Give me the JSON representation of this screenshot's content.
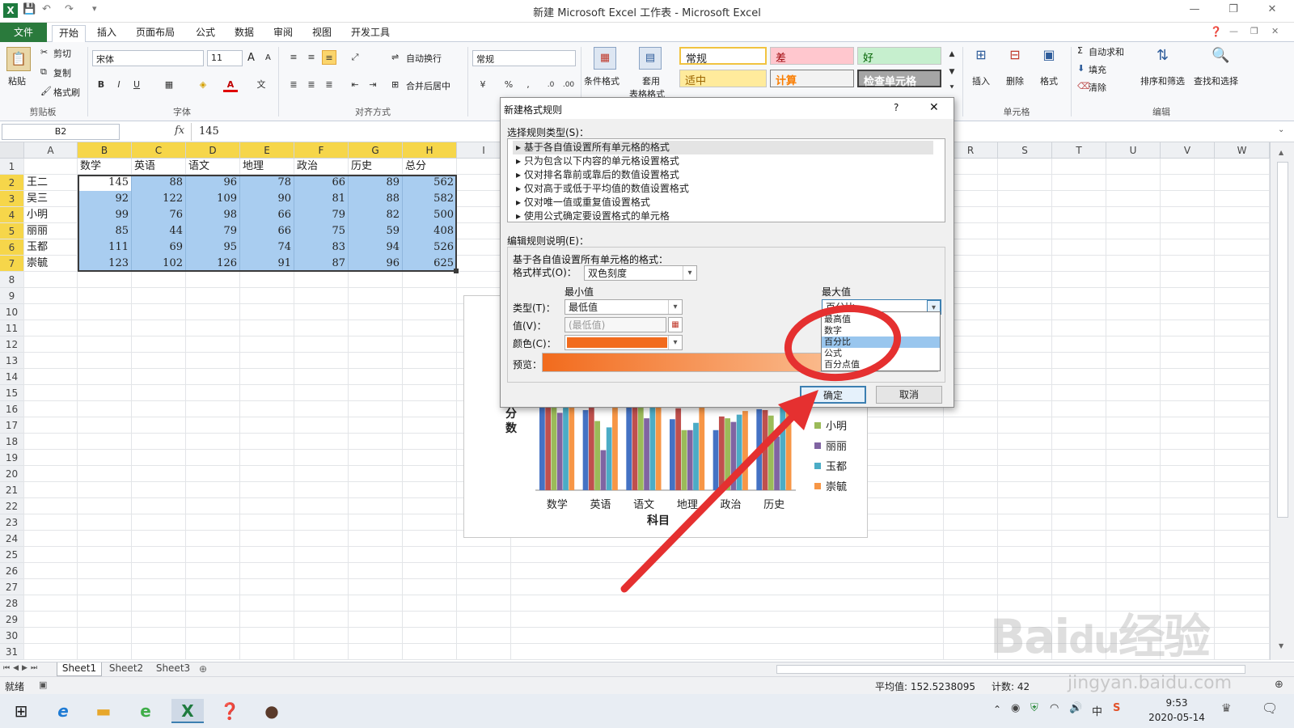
{
  "app": {
    "title": "新建 Microsoft Excel 工作表 - Microsoft Excel",
    "quick_access_menu": "▾"
  },
  "menu": {
    "file": "文件",
    "tabs": [
      "开始",
      "插入",
      "页面布局",
      "公式",
      "数据",
      "审阅",
      "视图",
      "开发工具"
    ]
  },
  "ribbon": {
    "clipboard": {
      "paste": "粘贴",
      "cut": "剪切",
      "copy": "复制",
      "format_painter": "格式刷",
      "label": "剪贴板"
    },
    "font": {
      "name": "宋体",
      "size": "11",
      "grow": "A",
      "shrink": "A",
      "bold": "B",
      "italic": "I",
      "underline": "U",
      "font_color_letter": "A",
      "label": "字体"
    },
    "alignment": {
      "wrap": "自动换行",
      "merge": "合并后居中",
      "label": "对齐方式"
    },
    "number": {
      "format": "常规",
      "percent": "%",
      "comma": ","
    },
    "styles": {
      "conditional": "条件格式",
      "table": "套用",
      "table2": "表格格式",
      "normal": "常规",
      "bad": "差",
      "good": "好",
      "neutral": "适中",
      "calc": "计算",
      "check": "检查单元格"
    },
    "cells": {
      "insert": "插入",
      "delete": "删除",
      "format": "格式",
      "label": "单元格"
    },
    "editing": {
      "autosum": "自动求和",
      "fill": "填充",
      "clear": "清除",
      "sort": "排序和筛选",
      "find": "查找和选择",
      "label": "编辑"
    }
  },
  "formula_bar": {
    "name_box": "B2",
    "fx": "fx",
    "value": "145"
  },
  "columns_left": [
    "A",
    "B",
    "C",
    "D",
    "E",
    "F",
    "G",
    "H",
    "I"
  ],
  "columns_right": [
    "R",
    "S",
    "T",
    "U",
    "V",
    "W"
  ],
  "rows": [
    "1",
    "2",
    "3",
    "4",
    "5",
    "6",
    "7",
    "8",
    "9",
    "10",
    "11",
    "12",
    "13",
    "14",
    "15",
    "16",
    "17",
    "18",
    "19",
    "20",
    "21",
    "22",
    "23",
    "24",
    "25",
    "26",
    "27",
    "28",
    "29",
    "30",
    "31"
  ],
  "table": {
    "headers": [
      "",
      "数学",
      "英语",
      "语文",
      "地理",
      "政治",
      "历史",
      "总分"
    ],
    "data": [
      [
        "王二",
        "145",
        "88",
        "96",
        "78",
        "66",
        "89",
        "562"
      ],
      [
        "吴三",
        "92",
        "122",
        "109",
        "90",
        "81",
        "88",
        "582"
      ],
      [
        "小明",
        "99",
        "76",
        "98",
        "66",
        "79",
        "82",
        "500"
      ],
      [
        "丽丽",
        "85",
        "44",
        "79",
        "66",
        "75",
        "59",
        "408"
      ],
      [
        "玉都",
        "111",
        "69",
        "95",
        "74",
        "83",
        "94",
        "526"
      ],
      [
        "崇毓",
        "123",
        "102",
        "126",
        "91",
        "87",
        "96",
        "625"
      ]
    ]
  },
  "chart_data": {
    "type": "bar",
    "categories": [
      "数学",
      "英语",
      "语文",
      "地理",
      "政治",
      "历史"
    ],
    "series": [
      {
        "name": "王二",
        "values": [
          145,
          88,
          96,
          78,
          66,
          89
        ],
        "color": "#4472c4"
      },
      {
        "name": "吴三",
        "values": [
          92,
          122,
          109,
          90,
          81,
          88
        ],
        "color": "#c0504d"
      },
      {
        "name": "小明",
        "values": [
          99,
          76,
          98,
          66,
          79,
          82
        ],
        "color": "#9bbb59"
      },
      {
        "name": "丽丽",
        "values": [
          85,
          44,
          79,
          66,
          75,
          59
        ],
        "color": "#8064a2"
      },
      {
        "name": "玉都",
        "values": [
          111,
          69,
          95,
          74,
          83,
          94
        ],
        "color": "#4bacc6"
      },
      {
        "name": "崇毓",
        "values": [
          123,
          102,
          126,
          91,
          87,
          96
        ],
        "color": "#f79646"
      }
    ],
    "xlabel": "科目",
    "ylabel": "分数",
    "legend_position": "right",
    "visible_legend": [
      "小明",
      "丽丽",
      "玉都",
      "崇毓"
    ]
  },
  "dialog": {
    "title": "新建格式规则",
    "help": "?",
    "close": "✕",
    "rule_type_label": "选择规则类型(S)：",
    "rule_types": [
      "基于各自值设置所有单元格的格式",
      "只为包含以下内容的单元格设置格式",
      "仅对排名靠前或靠后的数值设置格式",
      "仅对高于或低于平均值的数值设置格式",
      "仅对唯一值或重复值设置格式",
      "使用公式确定要设置格式的单元格"
    ],
    "edit_label": "编辑规则说明(E)：",
    "edit_desc": "基于各自值设置所有单元格的格式：",
    "style_label": "格式样式(O)：",
    "style_value": "双色刻度",
    "min_label": "最小值",
    "max_label": "最大值",
    "type_label": "类型(T)：",
    "value_label": "值(V)：",
    "color_label": "颜色(C)：",
    "preview_label": "预览：",
    "min_type": "最低值",
    "min_value_placeholder": "(最低值)",
    "max_type": "百分比",
    "max_options": [
      "最高值",
      "数字",
      "百分比",
      "公式",
      "百分点值"
    ],
    "selected_max_option": "百分比",
    "ok": "确定",
    "cancel": "取消",
    "colors": {
      "min": "#f26b1d",
      "preview_start": "#f26b1d",
      "preview_end": "#fdd9b8"
    }
  },
  "sheets": [
    "Sheet1",
    "Sheet2",
    "Sheet3"
  ],
  "status": {
    "ready": "就绪",
    "average": "平均值: 152.5238095",
    "count": "计数: 42"
  },
  "taskbar": {
    "time": "9:53",
    "date": "2020-05-14",
    "ime": "中"
  },
  "watermark": "Baidu经验 jingyan.baidu.com",
  "annotation_color": "#e53030"
}
